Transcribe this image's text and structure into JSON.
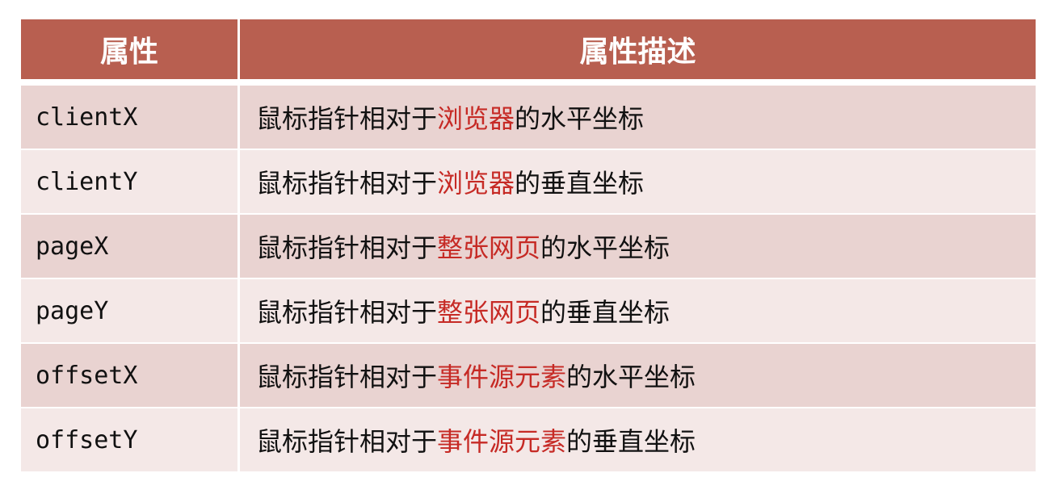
{
  "header": {
    "col1": "属性",
    "col2": "属性描述"
  },
  "rows": [
    {
      "name": "clientX",
      "prefix": "鼠标指针相对于",
      "target": "浏览器",
      "suffix": "的水平坐标"
    },
    {
      "name": "clientY",
      "prefix": "鼠标指针相对于",
      "target": "浏览器",
      "suffix": "的垂直坐标"
    },
    {
      "name": "pageX",
      "prefix": "鼠标指针相对于",
      "target": "整张网页",
      "suffix": "的水平坐标"
    },
    {
      "name": "pageY",
      "prefix": "鼠标指针相对于",
      "target": "整张网页",
      "suffix": "的垂直坐标"
    },
    {
      "name": "offsetX",
      "prefix": "鼠标指针相对于",
      "target": "事件源元素",
      "suffix": "的水平坐标"
    },
    {
      "name": "offsetY",
      "prefix": "鼠标指针相对于",
      "target": "事件源元素",
      "suffix": "的垂直坐标"
    }
  ],
  "colors": {
    "header": "#b85f50",
    "row_odd": "#e9d3d1",
    "row_even": "#f4e8e7",
    "highlight": "#c62a25"
  }
}
